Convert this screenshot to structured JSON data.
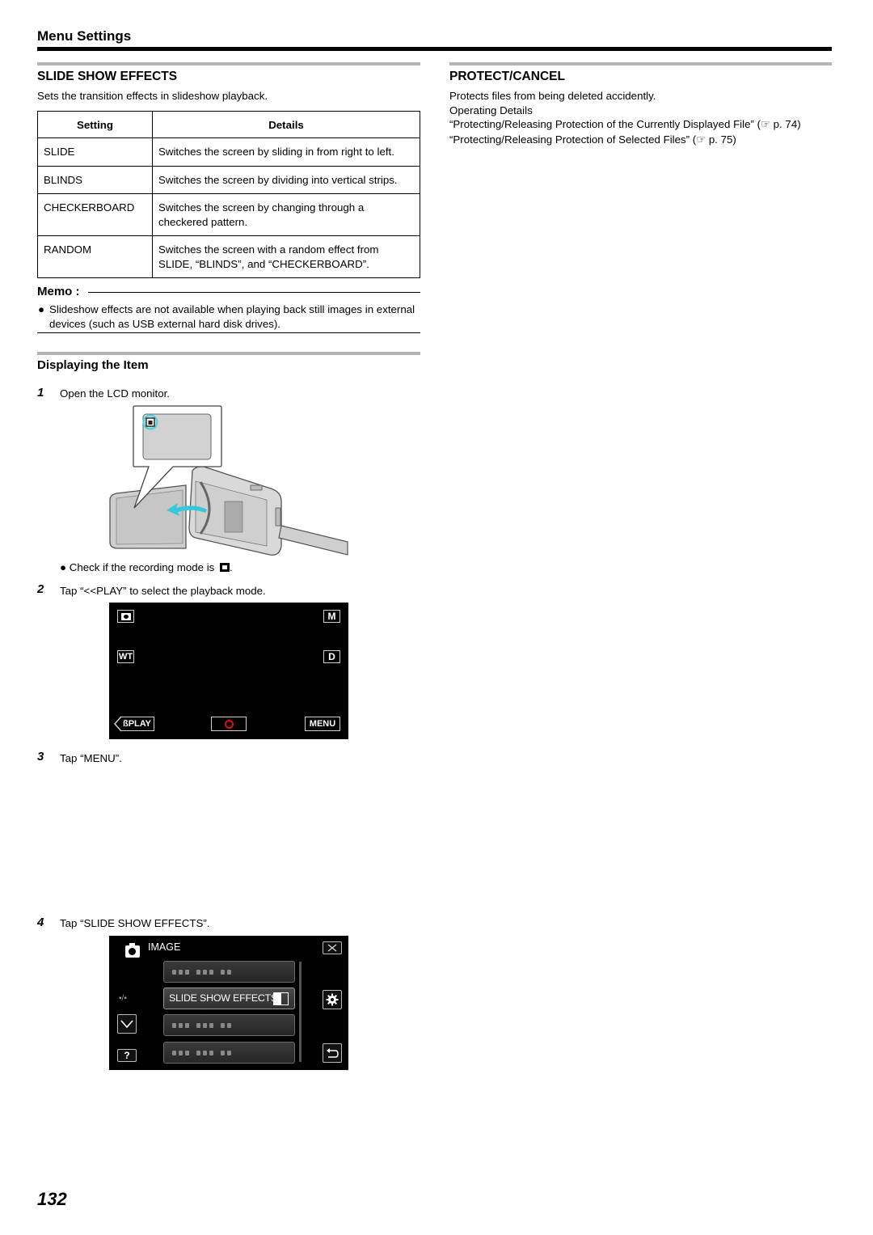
{
  "header": {
    "title": "Menu Settings"
  },
  "slide_show_effects": {
    "title": "SLIDE SHOW EFFECTS",
    "description": "Sets the transition effects in slideshow playback.",
    "table": {
      "headers": [
        "Setting",
        "Details"
      ],
      "rows": [
        {
          "setting": "SLIDE",
          "details": "Switches the screen by sliding in from right to left."
        },
        {
          "setting": "BLINDS",
          "details": "Switches the screen by dividing into vertical strips."
        },
        {
          "setting": "CHECKERBOARD",
          "details": "Switches the screen by changing through a checkered pattern."
        },
        {
          "setting": "RANDOM",
          "details": "Switches the screen with a random effect from SLIDE, “BLINDS”, and “CHECKERBOARD”."
        }
      ]
    }
  },
  "memo": {
    "title": "Memo :",
    "bullets": [
      "Slideshow effects are not available when playing back still images in external devices (such as USB external hard disk drives)."
    ]
  },
  "displaying_item": {
    "title": "Displaying the Item",
    "steps": [
      {
        "num": "1",
        "text": "Open the LCD monitor.",
        "note": "Check if the recording mode is"
      },
      {
        "num": "2",
        "text": "Tap “<<PLAY” to select the playback mode."
      },
      {
        "num": "3",
        "text": "Tap “MENU”."
      },
      {
        "num": "4",
        "text": "Tap “SLIDE SHOW EFFECTS”."
      }
    ],
    "camera_screen": {
      "mode_icon": "camera-icon",
      "m_label": "M",
      "wt_label": "WT",
      "d_label": "D",
      "play_label": "ßPLAY",
      "menu_label": "MENU",
      "record_icon": "record-circle-icon",
      "record_color": "#e01010"
    },
    "menu_screen": {
      "category": "IMAGE",
      "page_indicator": "▪/▪",
      "selected_item": "SLIDE SHOW EFFECTS",
      "items": [
        "",
        "SLIDE SHOW EFFECTS",
        "",
        ""
      ],
      "help_label": "?"
    },
    "highlight_color": "#3fd6e6"
  },
  "protect_cancel": {
    "title": "PROTECT/CANCEL",
    "lines": [
      "Protects files from being deleted accidently.",
      "Operating Details",
      "“Protecting/Releasing Protection of the Currently Displayed File” (☞ p. 74)",
      "“Protecting/Releasing Protection of Selected Files” (☞ p. 75)"
    ]
  },
  "page_number": "132"
}
